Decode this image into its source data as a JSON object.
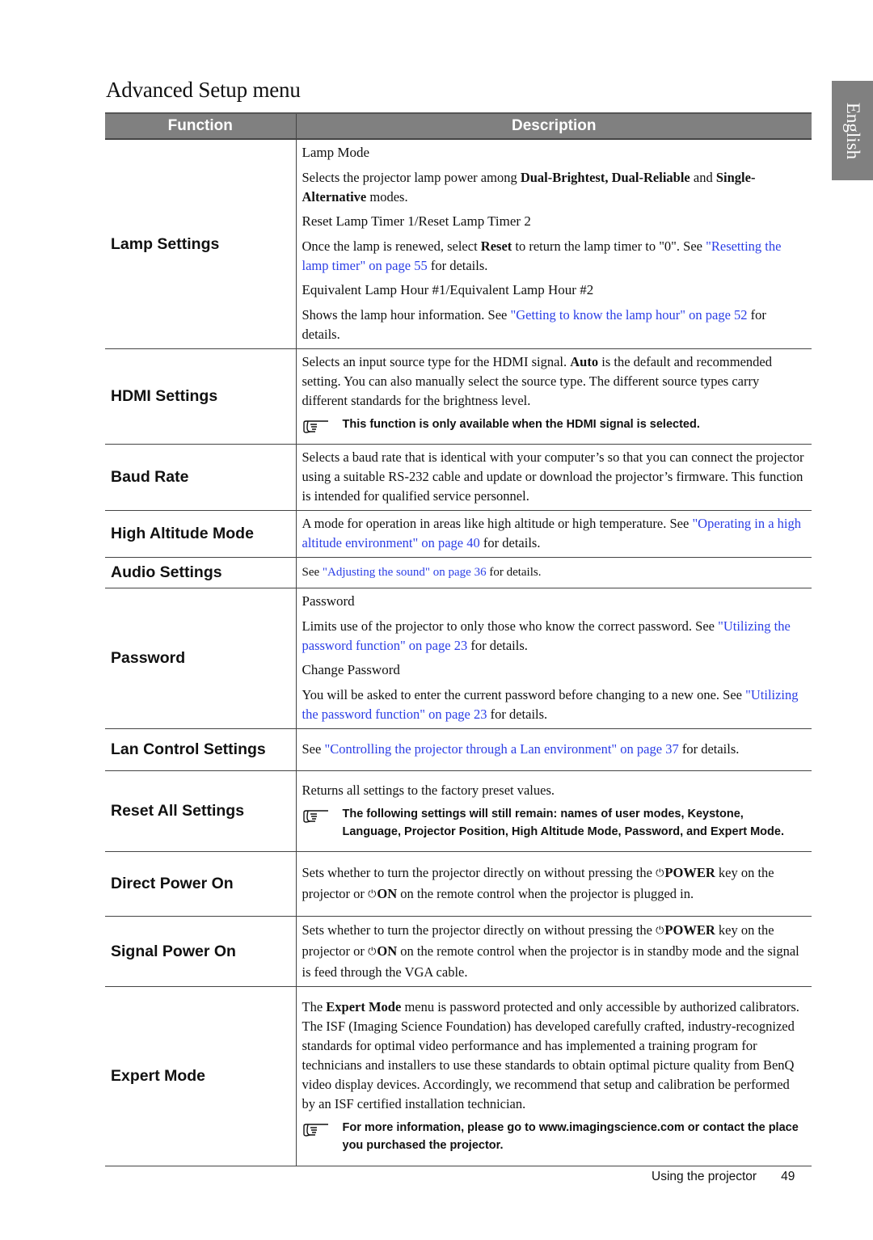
{
  "page": {
    "title": "Advanced Setup menu",
    "language_tab": "English",
    "footer_section": "Using the projector",
    "page_number": "49",
    "link_color": "#2b3ee6",
    "header_color": "#808080"
  },
  "table": {
    "headers": {
      "function": "Function",
      "description": "Description"
    },
    "rows": {
      "lamp": {
        "function": "Lamp Settings",
        "lamp_mode": {
          "title": "Lamp Mode",
          "t1": "Selects the projector lamp power among ",
          "b1": "Dual-Brightest",
          "t2": ", ",
          "b2": "Dual-Reliable",
          "t3": " and ",
          "b3": "Single-Alternative",
          "t4": " modes."
        },
        "reset_timer": {
          "title": "Reset Lamp Timer 1/Reset Lamp Timer 2",
          "t1": "Once the lamp is renewed, select ",
          "b1": "Reset",
          "t2": " to return the lamp timer to \"0\". See ",
          "link": "\"Resetting the lamp timer\" on page 55",
          "t3": " for details."
        },
        "lamp_hour": {
          "title": "Equivalent Lamp Hour #1/Equivalent Lamp Hour #2",
          "t1": "Shows the lamp hour information. See ",
          "link": "\"Getting to know the lamp hour\" on page 52",
          "t2": " for details."
        }
      },
      "hdmi": {
        "function": "HDMI Settings",
        "t1": "Selects an input source type for the HDMI signal. ",
        "b1": "Auto",
        "t2": " is the default and recommended setting. You can also manually select the source type. The different source types carry different standards for the brightness level.",
        "note": "This function is only available when the HDMI signal is selected."
      },
      "baud": {
        "function": "Baud Rate",
        "text": "Selects a baud rate that is identical with your computer’s so that you can connect the projector using a suitable RS-232 cable and update or download the projector’s firmware. This function is intended for qualified service personnel."
      },
      "altitude": {
        "function": "High Altitude Mode",
        "t1": "A mode for operation in areas like high altitude or high temperature. See ",
        "link": "\"Operating in a high altitude environment\" on page 40",
        "t2": " for details."
      },
      "audio": {
        "function": "Audio Settings",
        "t1": "See ",
        "link": "\"Adjusting the sound\" on page 36",
        "t2": " for details."
      },
      "password": {
        "function": "Password",
        "password": {
          "title": "Password",
          "t1": "Limits use of the projector to only those who know the correct password. See ",
          "link": "\"Utilizing the password function\" on page 23",
          "t2": " for details."
        },
        "change": {
          "title": "Change Password",
          "t1": "You will be asked to enter the current password before changing to a new one. See ",
          "link": "\"Utilizing the password function\" on page 23",
          "t2": " for details."
        }
      },
      "lan": {
        "function": "Lan Control Settings",
        "t1": "See ",
        "link": "\"Controlling the projector through a Lan environment\" on page 37",
        "t2": " for details."
      },
      "reset_all": {
        "function": "Reset All Settings",
        "text": "Returns all settings to the factory preset values.",
        "note": "The following settings will still remain: names of user modes, Keystone, Language, Projector Position, High Altitude Mode, Password, and Expert Mode."
      },
      "direct_power": {
        "function": "Direct Power On",
        "t1": "Sets whether to turn the projector directly on without pressing the ",
        "b1": "POWER",
        "t2": " key on the projector or ",
        "b2": "ON",
        "t3": " on the remote control when the projector is plugged in."
      },
      "signal_power": {
        "function": "Signal Power On",
        "t1": "Sets whether to turn the projector directly on without pressing the ",
        "b1": "POWER",
        "t2": " key on the projector or ",
        "b2": "ON",
        "t3": " on the remote control when the projector is in standby mode and the signal is feed through the VGA cable."
      },
      "expert": {
        "function": "Expert Mode",
        "t1": "The ",
        "b1": "Expert Mode",
        "t2": " menu is password protected and only accessible by authorized calibrators. The ISF (Imaging Science Foundation) has developed carefully crafted, industry-recognized standards for optimal video performance and has implemented a training program for technicians and installers to use these standards to obtain optimal picture quality from BenQ video display devices. Accordingly, we recommend that setup and calibration be performed by an ISF certified installation technician.",
        "note": "For more information, please go to www.imagingscience.com or contact the place you purchased the projector."
      }
    }
  },
  "icons": {
    "note": "pointing-hand-icon",
    "power": "power-icon"
  }
}
